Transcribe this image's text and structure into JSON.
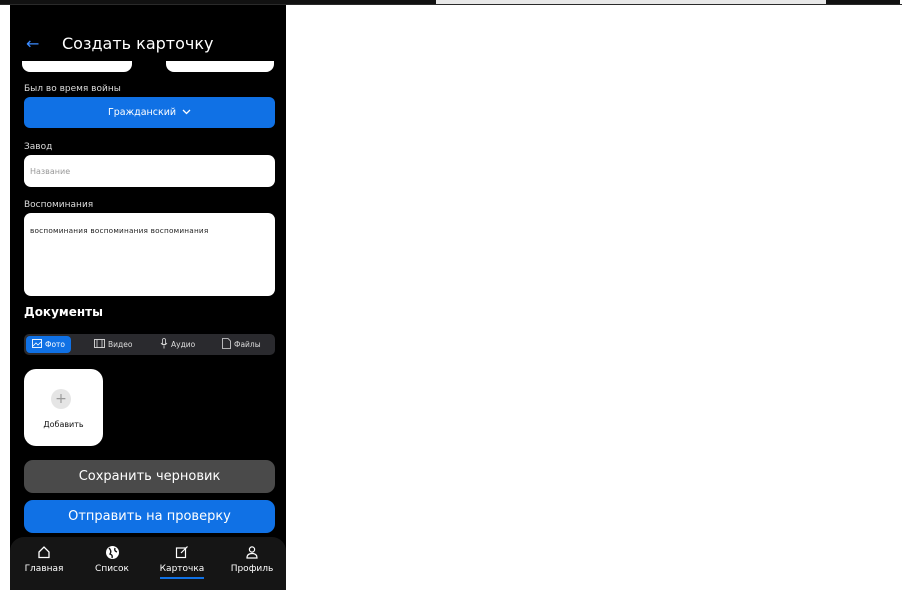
{
  "header": {
    "title": "Создать карточку"
  },
  "war": {
    "label": "Был во время войны",
    "selected": "Гражданский"
  },
  "factory": {
    "label": "Завод",
    "placeholder": "Название"
  },
  "memories": {
    "label": "Воспоминания",
    "value": "воспоминания воспоминания воспоминания"
  },
  "documents": {
    "title": "Документы",
    "tabs": [
      {
        "label": "Фото",
        "icon": "image-icon",
        "active": true
      },
      {
        "label": "Видео",
        "icon": "film-icon",
        "active": false
      },
      {
        "label": "Аудио",
        "icon": "microphone-icon",
        "active": false
      },
      {
        "label": "Файлы",
        "icon": "file-icon",
        "active": false
      }
    ],
    "add_label": "Добавить"
  },
  "actions": {
    "save_draft": "Сохранить черновик",
    "submit": "Отправить на проверку"
  },
  "nav": {
    "items": [
      {
        "label": "Главная",
        "icon": "home-icon"
      },
      {
        "label": "Список",
        "icon": "globe-icon"
      },
      {
        "label": "Карточка",
        "icon": "edit-icon",
        "active": true
      },
      {
        "label": "Профиль",
        "icon": "user-icon"
      }
    ]
  },
  "colors": {
    "accent": "#1071e5",
    "background": "#000000",
    "secondary_button": "#4a4a4a"
  }
}
